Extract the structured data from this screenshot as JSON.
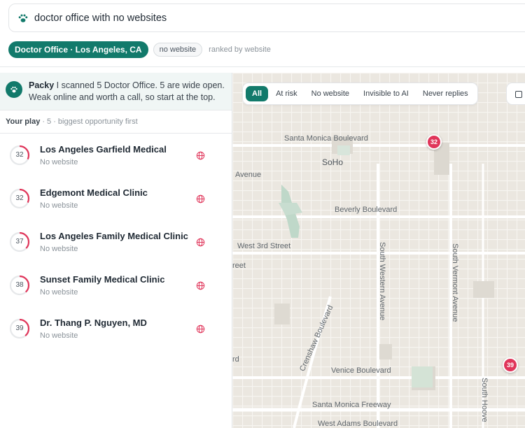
{
  "search": {
    "query": "doctor office with no websites",
    "icon": "paw-icon"
  },
  "chips": {
    "location": "Doctor Office · Los Angeles, CA",
    "filter": "no website",
    "hint": "ranked by website"
  },
  "assistant": {
    "name": "Packy",
    "message": "I scanned 5 Doctor Office. 5 are wide open. Weak online and worth a call, so start at the top."
  },
  "play": {
    "label": "Your play",
    "summary": "· 5 · biggest opportunity first"
  },
  "results": [
    {
      "score": "32",
      "name": "Los Angeles Garfield Medical",
      "status": "No website"
    },
    {
      "score": "32",
      "name": "Edgemont Medical Clinic",
      "status": "No website"
    },
    {
      "score": "37",
      "name": "Los Angeles Family Medical Clinic",
      "status": "No website"
    },
    {
      "score": "38",
      "name": "Sunset Family Medical Clinic",
      "status": "No website"
    },
    {
      "score": "39",
      "name": "Dr. Thang P. Nguyen, MD",
      "status": "No website"
    }
  ],
  "filters": {
    "all": "All",
    "at_risk": "At risk",
    "no_website": "No website",
    "invisible_ai": "Invisible to AI",
    "never_replies": "Never replies"
  },
  "map": {
    "labels": {
      "santa_monica_blvd": "Santa Monica Boulevard",
      "soho": "SoHo",
      "avenue": "Avenue",
      "beverly_blvd": "Beverly Boulevard",
      "west_3rd": "West 3rd Street",
      "reet": "reet",
      "south_western": "South Western Avenue",
      "south_vermont": "South Vermont Avenue",
      "crenshaw": "Crenshaw Boulevard",
      "rd": "rd",
      "venice_blvd": "Venice Boulevard",
      "santa_monica_fwy": "Santa Monica Freeway",
      "west_adams": "West Adams Boulevard",
      "south_hoover": "South Hoove"
    },
    "pins": [
      "32",
      "39"
    ]
  },
  "colors": {
    "accent": "#127a6b",
    "pin": "#e0355a",
    "ring": "#e0355a"
  }
}
